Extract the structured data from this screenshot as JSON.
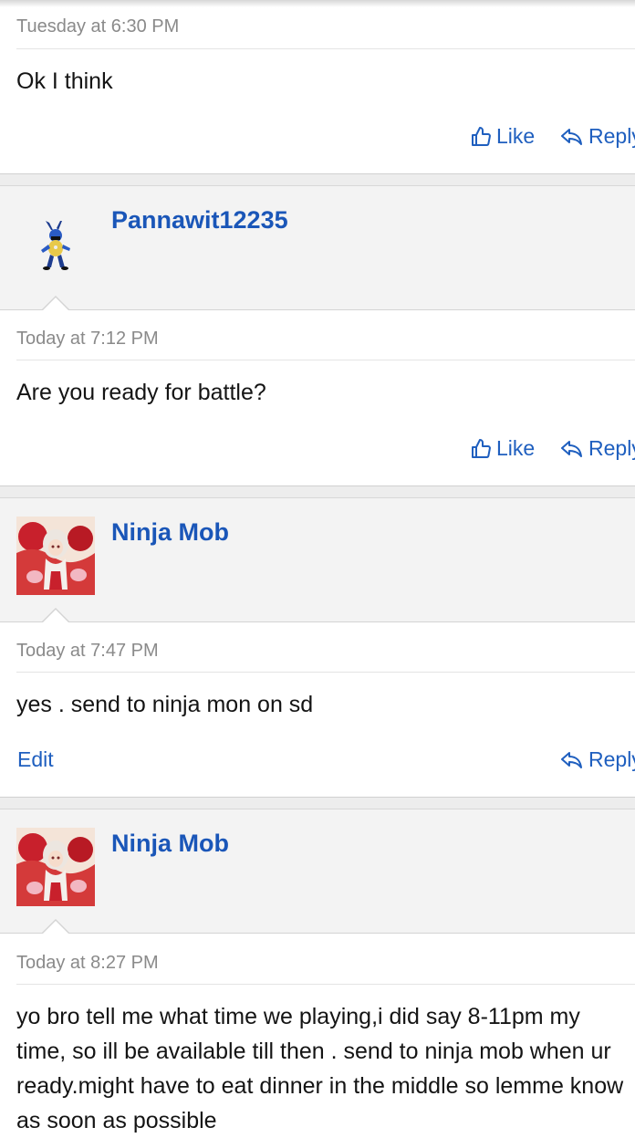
{
  "posts": [
    {
      "date": "Tuesday at 6:30 PM",
      "message": "Ok I think",
      "like_label": "Like",
      "reply_label": "Reply"
    },
    {
      "username": "Pannawit12235",
      "avatar_icon": "lucario-sprite",
      "date": "Today at 7:12 PM",
      "message": "Are you ready for battle?",
      "like_label": "Like",
      "reply_label": "Reply"
    },
    {
      "username": "Ninja Mob",
      "avatar_icon": "anime-character-avatar",
      "date": "Today at 7:47 PM",
      "message": "yes . send to ninja mon on sd",
      "edit_label": "Edit",
      "reply_label": "Reply"
    },
    {
      "username": "Ninja Mob",
      "avatar_icon": "anime-character-avatar",
      "date": "Today at 8:27 PM",
      "message": "yo bro tell me what time we playing,i did say 8-11pm my time, so ill be available till then . send to ninja mob when ur ready.might have to eat dinner in the middle so lemme know as soon as possible"
    }
  ],
  "colors": {
    "link": "#1f5fbf",
    "username": "#1a56b8",
    "date": "#8a8a8a",
    "userbox_bg": "#f3f3f3"
  }
}
